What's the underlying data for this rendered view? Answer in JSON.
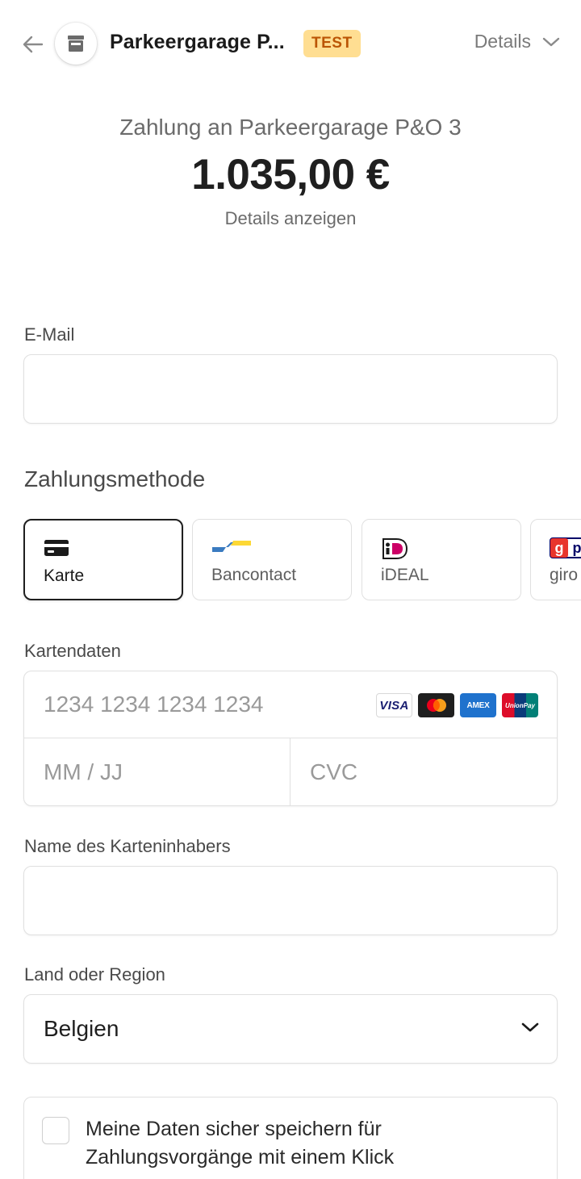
{
  "header": {
    "merchant_name": "Parkeergarage P...",
    "badge": "TEST",
    "details_label": "Details"
  },
  "summary": {
    "title": "Zahlung an Parkeergarage P&O 3",
    "amount": "1.035,00 €",
    "details_link": "Details anzeigen"
  },
  "email": {
    "label": "E-Mail",
    "value": "",
    "placeholder": ""
  },
  "payment_method": {
    "title": "Zahlungsmethode",
    "options": [
      {
        "label": "Karte",
        "icon": "card-icon",
        "selected": true
      },
      {
        "label": "Bancontact",
        "icon": "bancontact-icon",
        "selected": false
      },
      {
        "label": "iDEAL",
        "icon": "ideal-icon",
        "selected": false
      },
      {
        "label": "giro",
        "icon": "giropay-icon",
        "selected": false
      }
    ]
  },
  "card": {
    "label": "Kartendaten",
    "number_placeholder": "1234 1234 1234 1234",
    "expiry_placeholder": "MM / JJ",
    "cvc_placeholder": "CVC",
    "brands": [
      "VISA",
      "Mastercard",
      "AMEX",
      "UnionPay"
    ]
  },
  "cardholder": {
    "label": "Name des Karteninhabers",
    "value": ""
  },
  "country": {
    "label": "Land oder Region",
    "selected": "Belgien"
  },
  "save": {
    "text": "Meine Daten sicher speichern für Zahlungsvorgänge mit einem Klick",
    "checked": false
  },
  "colors": {
    "badge_bg": "#ffde92",
    "badge_text": "#bb5504",
    "border": "#e0e0e0",
    "selected_border": "#1f1f1f"
  }
}
